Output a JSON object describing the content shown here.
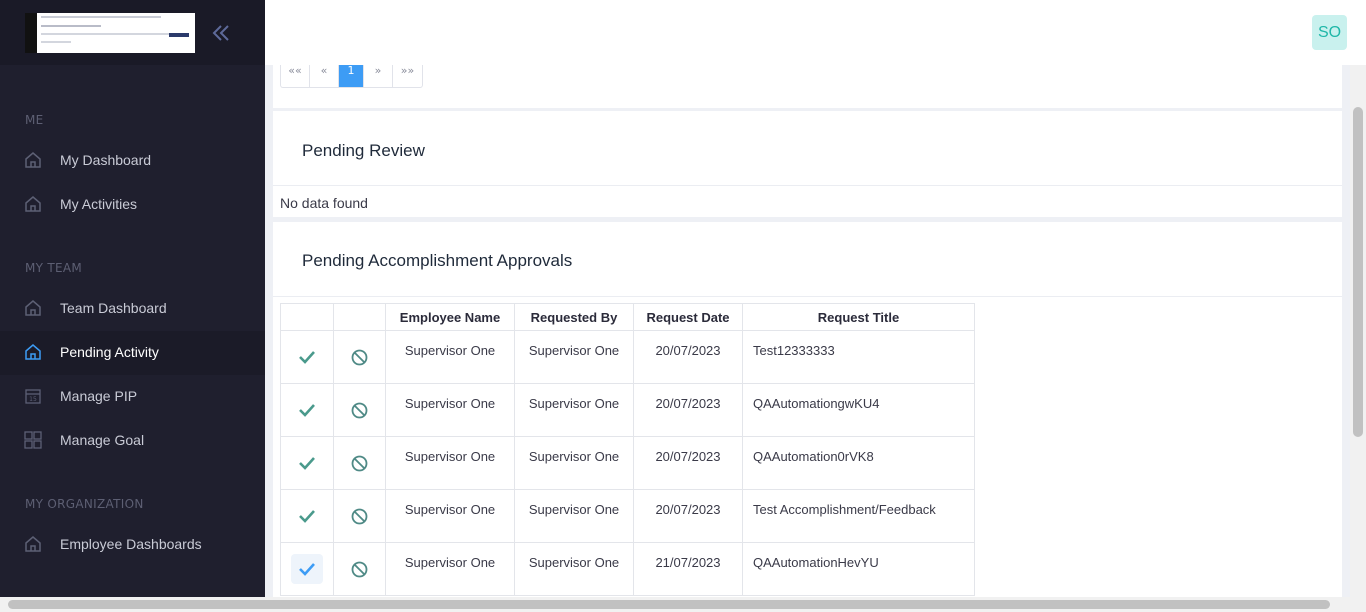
{
  "sidebar": {
    "sections": [
      {
        "label": "ME"
      },
      {
        "label": "MY TEAM"
      },
      {
        "label": "MY ORGANIZATION"
      }
    ],
    "items": [
      {
        "label": "My Dashboard",
        "icon": "home-icon"
      },
      {
        "label": "My Activities",
        "icon": "home-icon"
      },
      {
        "label": "Team Dashboard",
        "icon": "home-icon"
      },
      {
        "label": "Pending Activity",
        "icon": "home-icon",
        "active": true
      },
      {
        "label": "Manage PIP",
        "icon": "calendar-icon"
      },
      {
        "label": "Manage Goal",
        "icon": "grid-icon"
      },
      {
        "label": "Employee Dashboards",
        "icon": "home-icon"
      }
    ],
    "collapse_icon": "double-chevron-left-icon"
  },
  "header": {
    "avatar_initials": "SO"
  },
  "pagination": {
    "first": "««",
    "prev": "«",
    "current": "1",
    "next": "»",
    "last": "»»"
  },
  "pending_review": {
    "title": "Pending Review",
    "empty_text": "No data found"
  },
  "approvals": {
    "title": "Pending Accomplishment Approvals",
    "columns": [
      "",
      "",
      "Employee Name",
      "Requested By",
      "Request Date",
      "Request Title"
    ],
    "rows": [
      {
        "employee": "Supervisor One",
        "requested_by": "Supervisor One",
        "date": "20/07/2023",
        "title": "Test12333333"
      },
      {
        "employee": "Supervisor One",
        "requested_by": "Supervisor One",
        "date": "20/07/2023",
        "title": "QAAutomationgwKU4"
      },
      {
        "employee": "Supervisor One",
        "requested_by": "Supervisor One",
        "date": "20/07/2023",
        "title": "QAAutomation0rVK8"
      },
      {
        "employee": "Supervisor One",
        "requested_by": "Supervisor One",
        "date": "20/07/2023",
        "title": "Test Accomplishment/Feedback"
      },
      {
        "employee": "Supervisor One",
        "requested_by": "Supervisor One",
        "date": "21/07/2023",
        "title": "QAAutomationHevYU"
      }
    ]
  },
  "colors": {
    "sidebar_bg": "#1f1f2e",
    "accent": "#3d9cf5",
    "approve": "#4a9a8c",
    "reject": "#4f8a86",
    "avatar_bg": "#c9f1ee",
    "avatar_fg": "#1fb7a8"
  }
}
